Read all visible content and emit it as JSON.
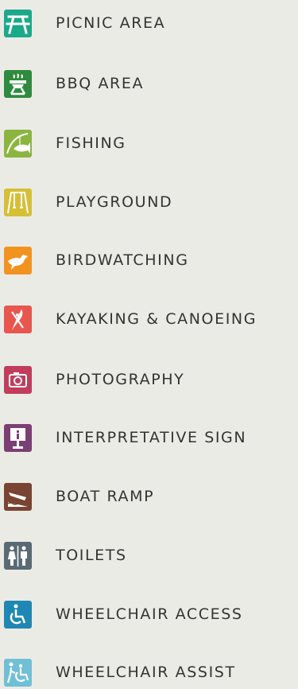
{
  "legend": {
    "items": [
      {
        "label": "PICNIC AREA",
        "icon": "picnic-table-icon",
        "color": "#1aa98a"
      },
      {
        "label": "BBQ AREA",
        "icon": "bbq-grill-icon",
        "color": "#2e8b3e"
      },
      {
        "label": "FISHING",
        "icon": "fishing-icon",
        "color": "#8bb540"
      },
      {
        "label": "PLAYGROUND",
        "icon": "swing-icon",
        "color": "#d6bf36"
      },
      {
        "label": "BIRDWATCHING",
        "icon": "bird-icon",
        "color": "#f3931f"
      },
      {
        "label": "KAYAKING & CANOEING",
        "icon": "kayak-paddle-icon",
        "color": "#e9564e"
      },
      {
        "label": "PHOTOGRAPHY",
        "icon": "camera-icon",
        "color": "#c23c5c"
      },
      {
        "label": "INTERPRETATIVE SIGN",
        "icon": "info-sign-icon",
        "color": "#7b3f73"
      },
      {
        "label": "BOAT RAMP",
        "icon": "boat-ramp-icon",
        "color": "#7a4433"
      },
      {
        "label": "TOILETS",
        "icon": "toilets-icon",
        "color": "#5a6a74"
      },
      {
        "label": "WHEELCHAIR ACCESS",
        "icon": "wheelchair-icon",
        "color": "#1f87b3"
      },
      {
        "label": "WHEELCHAIR ASSIST",
        "icon": "wheelchair-assist-icon",
        "color": "#6fc0d6"
      }
    ]
  }
}
